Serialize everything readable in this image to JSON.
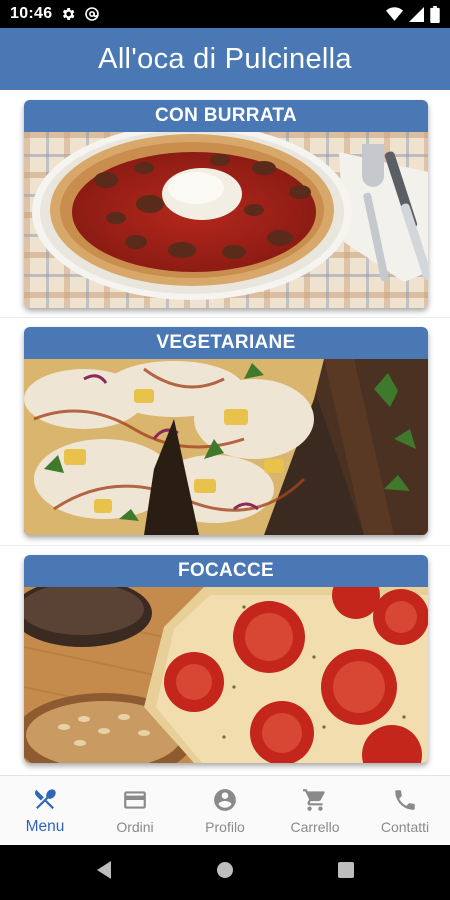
{
  "status_bar": {
    "time": "10:46",
    "left_icons": [
      "gear-icon",
      "at-sign-icon"
    ],
    "right_icons": [
      "wifi-icon",
      "signal-icon",
      "battery-icon"
    ]
  },
  "app_bar": {
    "title": "All'oca di Pulcinella"
  },
  "categories": [
    {
      "title": "CON BURRATA",
      "image": "pizza-burrata-image"
    },
    {
      "title": "VEGETARIANE",
      "image": "pizza-vegetariana-image"
    },
    {
      "title": "FOCACCE",
      "image": "focaccia-image"
    }
  ],
  "bottom_nav": {
    "items": [
      {
        "label": "Menu",
        "icon": "fork-knife-icon",
        "active": true
      },
      {
        "label": "Ordini",
        "icon": "credit-card-icon",
        "active": false
      },
      {
        "label": "Profilo",
        "icon": "account-circle-icon",
        "active": false
      },
      {
        "label": "Carrello",
        "icon": "cart-icon",
        "active": false
      },
      {
        "label": "Contatti",
        "icon": "phone-icon",
        "active": false
      }
    ]
  },
  "colors": {
    "primary": "#4a78b4",
    "nav_active": "#2f66b8",
    "nav_inactive": "#8a8a8a"
  }
}
